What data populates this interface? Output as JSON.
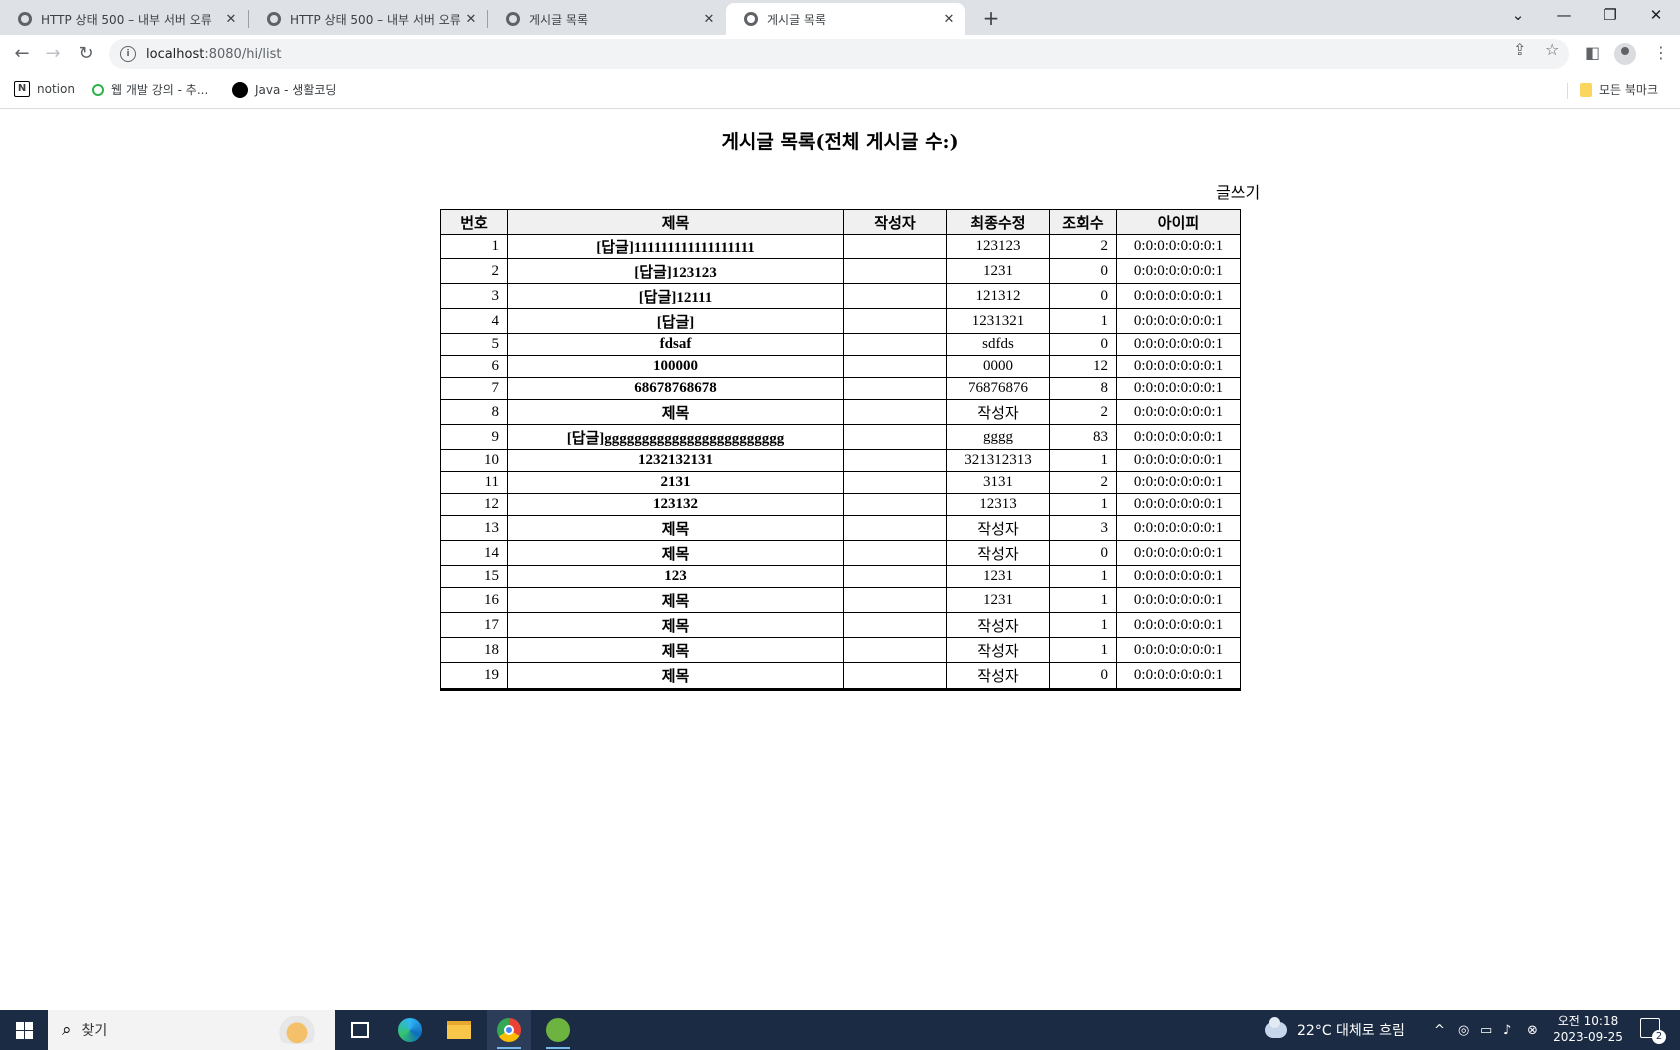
{
  "browser": {
    "tabs": [
      {
        "title": "HTTP 상태 500 – 내부 서버 오류",
        "active": false
      },
      {
        "title": "HTTP 상태 500 – 내부 서버 오류",
        "active": false
      },
      {
        "title": "게시글 목록",
        "active": false
      },
      {
        "title": "게시글 목록",
        "active": true
      }
    ],
    "new_tab_icon": "plus-icon",
    "url_host": "localhost",
    "url_rest": ":8080/hi/list",
    "bookmarks": [
      {
        "label": "notion",
        "icon": "notion-icon"
      },
      {
        "label": "웹 개발 강의 - 추...",
        "icon": "green-circle-icon"
      },
      {
        "label": "Java - 생활코딩",
        "icon": "black-circle-icon"
      }
    ],
    "all_bookmarks_label": "모든 북마크"
  },
  "page": {
    "title": "게시글 목록(전체 게시글 수:)",
    "write_link": "글쓰기",
    "columns": [
      "번호",
      "제목",
      "작성자",
      "최종수정",
      "조회수",
      "아이피"
    ],
    "rows": [
      {
        "no": "1",
        "subject": "[답글]111111111111111111",
        "writer": "",
        "modified": "123123",
        "views": "2",
        "ip": "0:0:0:0:0:0:0:1"
      },
      {
        "no": "2",
        "subject": "[답글]123123",
        "writer": "",
        "modified": "1231",
        "views": "0",
        "ip": "0:0:0:0:0:0:0:1"
      },
      {
        "no": "3",
        "subject": "[답글]12111",
        "writer": "",
        "modified": "121312",
        "views": "0",
        "ip": "0:0:0:0:0:0:0:1"
      },
      {
        "no": "4",
        "subject": "[답글]",
        "writer": "",
        "modified": "1231321",
        "views": "1",
        "ip": "0:0:0:0:0:0:0:1"
      },
      {
        "no": "5",
        "subject": "fdsaf",
        "writer": "",
        "modified": "sdfds",
        "views": "0",
        "ip": "0:0:0:0:0:0:0:1"
      },
      {
        "no": "6",
        "subject": "100000",
        "writer": "",
        "modified": "0000",
        "views": "12",
        "ip": "0:0:0:0:0:0:0:1"
      },
      {
        "no": "7",
        "subject": "68678768678",
        "writer": "",
        "modified": "76876876",
        "views": "8",
        "ip": "0:0:0:0:0:0:0:1"
      },
      {
        "no": "8",
        "subject": "제목",
        "writer": "",
        "modified": "작성자",
        "views": "2",
        "ip": "0:0:0:0:0:0:0:1"
      },
      {
        "no": "9",
        "subject": "[답글]gggggggggggggggggggggggg",
        "writer": "",
        "modified": "gggg",
        "views": "83",
        "ip": "0:0:0:0:0:0:0:1"
      },
      {
        "no": "10",
        "subject": "1232132131",
        "writer": "",
        "modified": "321312313",
        "views": "1",
        "ip": "0:0:0:0:0:0:0:1"
      },
      {
        "no": "11",
        "subject": "2131",
        "writer": "",
        "modified": "3131",
        "views": "2",
        "ip": "0:0:0:0:0:0:0:1"
      },
      {
        "no": "12",
        "subject": "123132",
        "writer": "",
        "modified": "12313",
        "views": "1",
        "ip": "0:0:0:0:0:0:0:1"
      },
      {
        "no": "13",
        "subject": "제목",
        "writer": "",
        "modified": "작성자",
        "views": "3",
        "ip": "0:0:0:0:0:0:0:1"
      },
      {
        "no": "14",
        "subject": "제목",
        "writer": "",
        "modified": "작성자",
        "views": "0",
        "ip": "0:0:0:0:0:0:0:1"
      },
      {
        "no": "15",
        "subject": "123",
        "writer": "",
        "modified": "1231",
        "views": "1",
        "ip": "0:0:0:0:0:0:0:1"
      },
      {
        "no": "16",
        "subject": "제목",
        "writer": "",
        "modified": "1231",
        "views": "1",
        "ip": "0:0:0:0:0:0:0:1"
      },
      {
        "no": "17",
        "subject": "제목",
        "writer": "",
        "modified": "작성자",
        "views": "1",
        "ip": "0:0:0:0:0:0:0:1"
      },
      {
        "no": "18",
        "subject": "제목",
        "writer": "",
        "modified": "작성자",
        "views": "1",
        "ip": "0:0:0:0:0:0:0:1"
      },
      {
        "no": "19",
        "subject": "제목",
        "writer": "",
        "modified": "작성자",
        "views": "0",
        "ip": "0:0:0:0:0:0:0:1"
      }
    ]
  },
  "taskbar": {
    "search_placeholder": "찾기",
    "weather": "22°C 대체로 흐림",
    "time": "오전 10:18",
    "date": "2023-09-25",
    "notification_count": "2"
  }
}
